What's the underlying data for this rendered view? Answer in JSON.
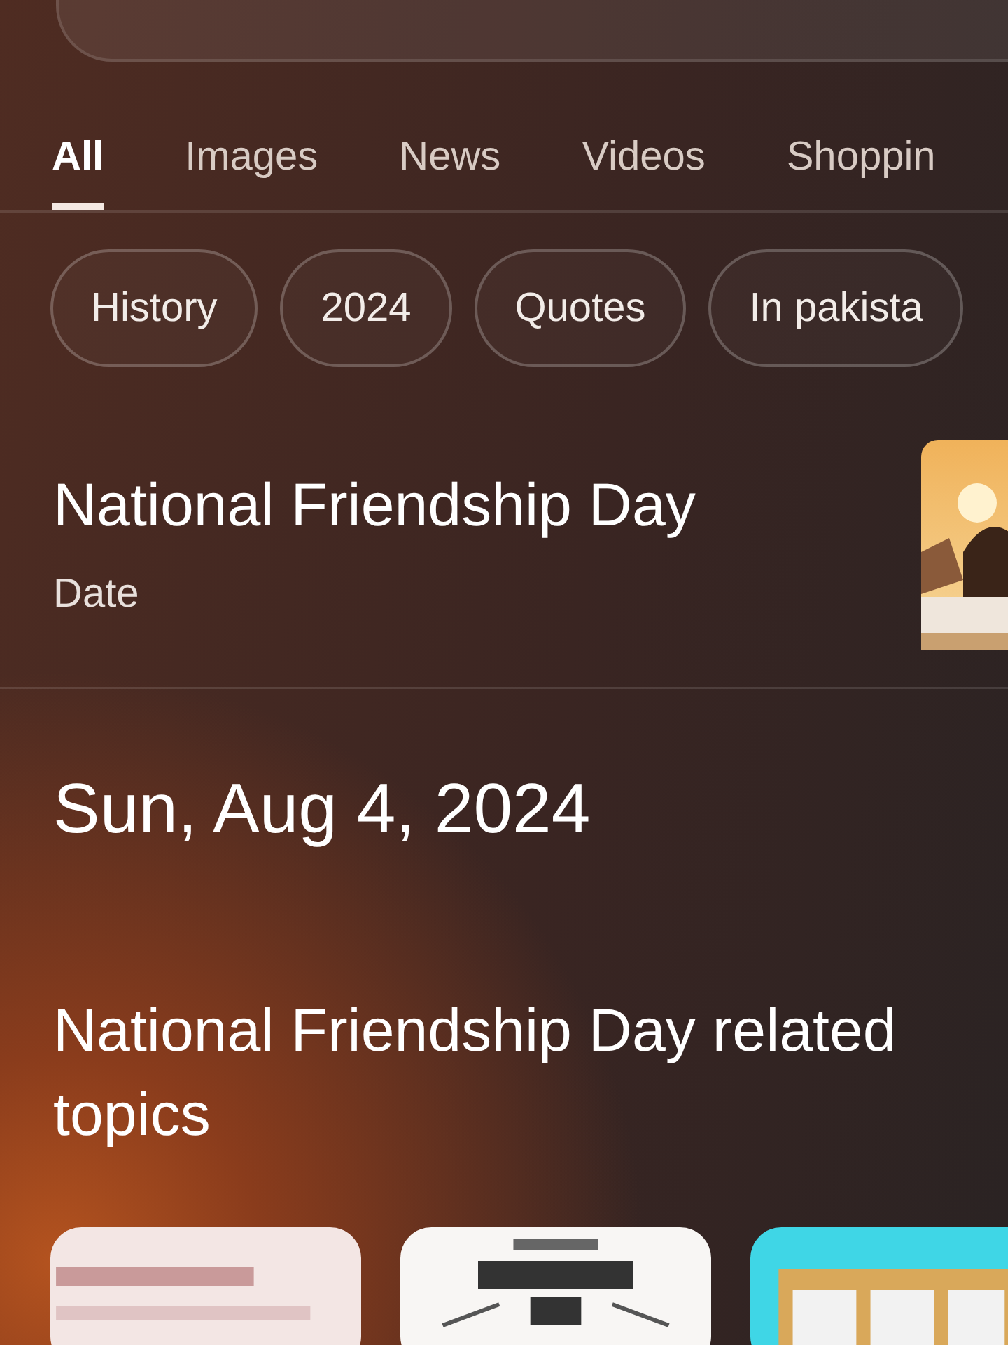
{
  "tabs": [
    {
      "label": "All",
      "selected": true
    },
    {
      "label": "Images",
      "selected": false
    },
    {
      "label": "News",
      "selected": false
    },
    {
      "label": "Videos",
      "selected": false
    },
    {
      "label": "Shoppin",
      "selected": false
    }
  ],
  "chips": [
    "History",
    "2024",
    "Quotes",
    "In pakista"
  ],
  "result": {
    "title": "National Friendship Day",
    "subtitle": "Date"
  },
  "answer": "Sun, Aug 4, 2024",
  "related": {
    "title": "National Friendship Day related topics"
  }
}
